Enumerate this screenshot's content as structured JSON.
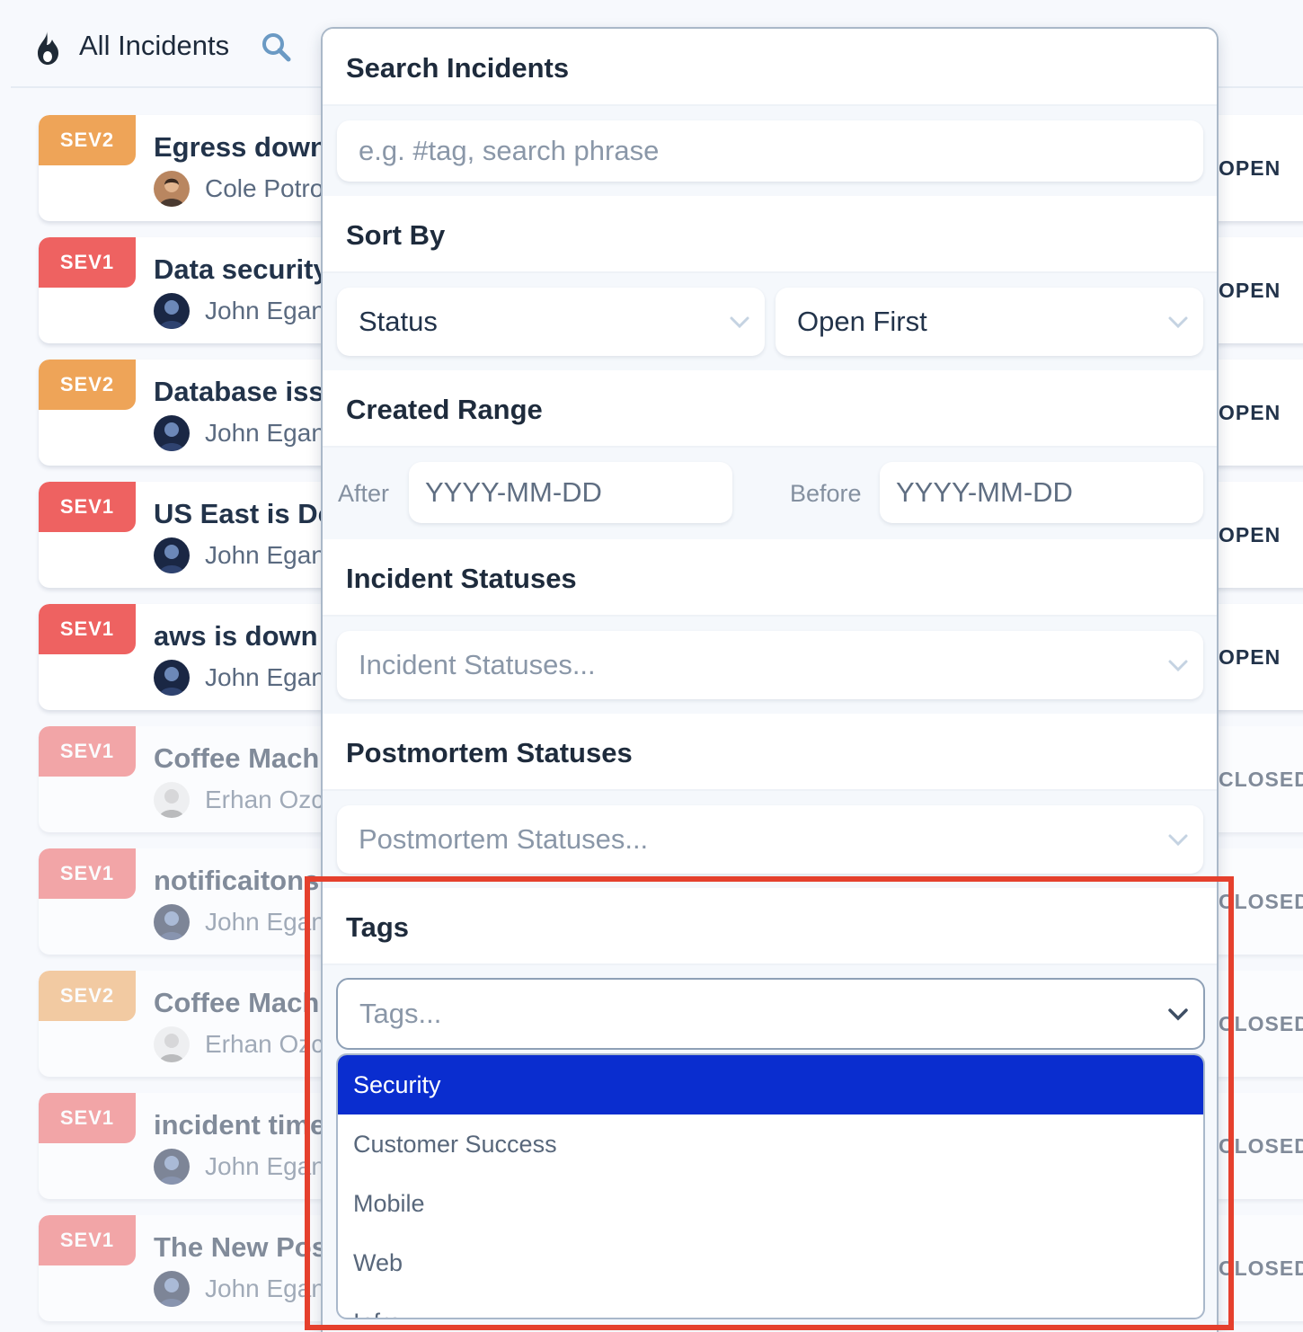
{
  "header": {
    "title": "All Incidents",
    "logo_icon": "flame-icon",
    "search_icon": "search-icon"
  },
  "incidents": [
    {
      "severity": "SEV2",
      "title": "Egress down",
      "owner": "Cole Potrocky",
      "status": "OPEN"
    },
    {
      "severity": "SEV1",
      "title": "Data security",
      "owner": "John Egan",
      "status": "OPEN"
    },
    {
      "severity": "SEV2",
      "title": "Database issue",
      "owner": "John Egan",
      "status": "OPEN"
    },
    {
      "severity": "SEV1",
      "title": "US East is Down",
      "owner": "John Egan",
      "status": "OPEN"
    },
    {
      "severity": "SEV1",
      "title": "aws is down",
      "owner": "John Egan",
      "status": "OPEN"
    },
    {
      "severity": "SEV1",
      "title": "Coffee Machine",
      "owner": "Erhan Ozcan",
      "status": "CLOSED"
    },
    {
      "severity": "SEV1",
      "title": "notificaitons",
      "owner": "John Egan",
      "status": "CLOSED"
    },
    {
      "severity": "SEV2",
      "title": "Coffee Machine",
      "owner": "Erhan Ozcan",
      "status": "CLOSED"
    },
    {
      "severity": "SEV1",
      "title": "incident timeline",
      "owner": "John Egan",
      "status": "CLOSED"
    },
    {
      "severity": "SEV1",
      "title": "The New Post",
      "owner": "John Egan",
      "status": "CLOSED"
    }
  ],
  "filters": {
    "search": {
      "heading": "Search Incidents",
      "placeholder": "e.g. #tag, search phrase"
    },
    "sort": {
      "heading": "Sort By",
      "field": "Status",
      "order": "Open First"
    },
    "range": {
      "heading": "Created Range",
      "after_label": "After",
      "before_label": "Before",
      "after_placeholder": "YYYY-MM-DD",
      "before_placeholder": "YYYY-MM-DD"
    },
    "incident_statuses": {
      "heading": "Incident Statuses",
      "placeholder": "Incident Statuses..."
    },
    "postmortem_statuses": {
      "heading": "Postmortem Statuses",
      "placeholder": "Postmortem Statuses..."
    },
    "tags": {
      "heading": "Tags",
      "placeholder": "Tags...",
      "options": [
        "Security",
        "Customer Success",
        "Mobile",
        "Web",
        "Infra"
      ]
    }
  },
  "colors": {
    "sev1": "#ee6261",
    "sev2": "#eea458",
    "selected_option": "#0a2dcf",
    "highlight": "#e5402d"
  }
}
